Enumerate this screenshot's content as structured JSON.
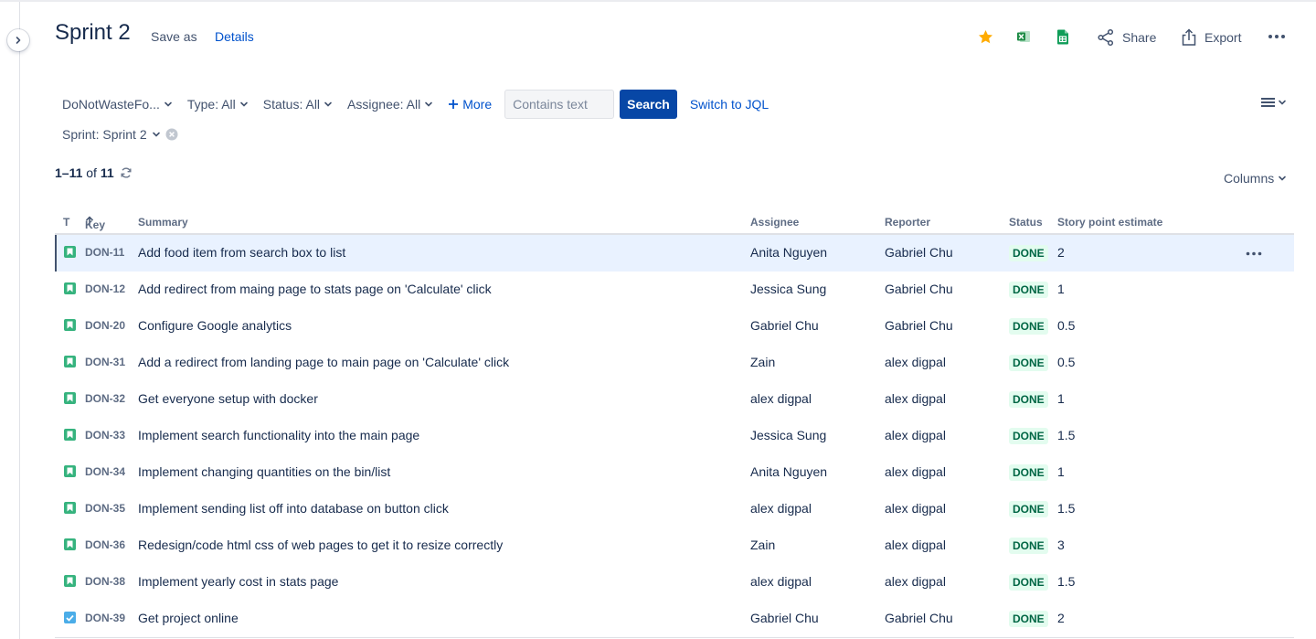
{
  "header": {
    "title": "Sprint 2",
    "save_as": "Save as",
    "details": "Details",
    "share": "Share",
    "export": "Export",
    "star_icon": "star-icon",
    "excel_icon": "excel-icon",
    "sheets_icon": "google-sheets-icon"
  },
  "filters": {
    "project": "DoNotWasteFo...",
    "type": "Type: All",
    "status": "Status: All",
    "assignee": "Assignee: All",
    "more": "More",
    "search_placeholder": "Contains text",
    "search_button": "Search",
    "switch_jql": "Switch to JQL",
    "sprint": "Sprint: Sprint 2"
  },
  "results": {
    "range": "1–11",
    "of": "of",
    "total": "11",
    "columns_button": "Columns"
  },
  "table": {
    "headers": {
      "type": "T",
      "key": "Key",
      "summary": "Summary",
      "assignee": "Assignee",
      "reporter": "Reporter",
      "status": "Status",
      "story_points": "Story point estimate"
    },
    "rows": [
      {
        "type": "story",
        "key": "DON-11",
        "summary": "Add food item from search box to list",
        "assignee": "Anita Nguyen",
        "reporter": "Gabriel Chu",
        "status": "DONE",
        "points": "2"
      },
      {
        "type": "story",
        "key": "DON-12",
        "summary": "Add redirect from maing page to stats page on 'Calculate' click",
        "assignee": "Jessica Sung",
        "reporter": "Gabriel Chu",
        "status": "DONE",
        "points": "1"
      },
      {
        "type": "story",
        "key": "DON-20",
        "summary": "Configure Google analytics",
        "assignee": "Gabriel Chu",
        "reporter": "Gabriel Chu",
        "status": "DONE",
        "points": "0.5"
      },
      {
        "type": "story",
        "key": "DON-31",
        "summary": "Add a redirect from landing page to main page on 'Calculate' click",
        "assignee": "Zain",
        "reporter": "alex digpal",
        "status": "DONE",
        "points": "0.5"
      },
      {
        "type": "story",
        "key": "DON-32",
        "summary": "Get everyone setup with docker",
        "assignee": "alex digpal",
        "reporter": "alex digpal",
        "status": "DONE",
        "points": "1"
      },
      {
        "type": "story",
        "key": "DON-33",
        "summary": "Implement search functionality into the main page",
        "assignee": "Jessica Sung",
        "reporter": "alex digpal",
        "status": "DONE",
        "points": "1.5"
      },
      {
        "type": "story",
        "key": "DON-34",
        "summary": "Implement changing quantities on the bin/list",
        "assignee": "Anita Nguyen",
        "reporter": "alex digpal",
        "status": "DONE",
        "points": "1"
      },
      {
        "type": "story",
        "key": "DON-35",
        "summary": "Implement sending list off into database on button click",
        "assignee": "alex digpal",
        "reporter": "alex digpal",
        "status": "DONE",
        "points": "1.5"
      },
      {
        "type": "story",
        "key": "DON-36",
        "summary": "Redesign/code html css of web pages to get it to resize correctly",
        "assignee": "Zain",
        "reporter": "alex digpal",
        "status": "DONE",
        "points": "3"
      },
      {
        "type": "story",
        "key": "DON-38",
        "summary": "Implement yearly cost in stats page",
        "assignee": "alex digpal",
        "reporter": "alex digpal",
        "status": "DONE",
        "points": "1.5"
      },
      {
        "type": "task",
        "key": "DON-39",
        "summary": "Get project online",
        "assignee": "Gabriel Chu",
        "reporter": "Gabriel Chu",
        "status": "DONE",
        "points": "2"
      }
    ]
  },
  "colors": {
    "primary": "#0747a6",
    "link": "#0052cc",
    "done_bg": "#e3fcef",
    "done_text": "#006644",
    "story": "#36b37e",
    "task": "#4bade8",
    "star": "#ffab00"
  }
}
